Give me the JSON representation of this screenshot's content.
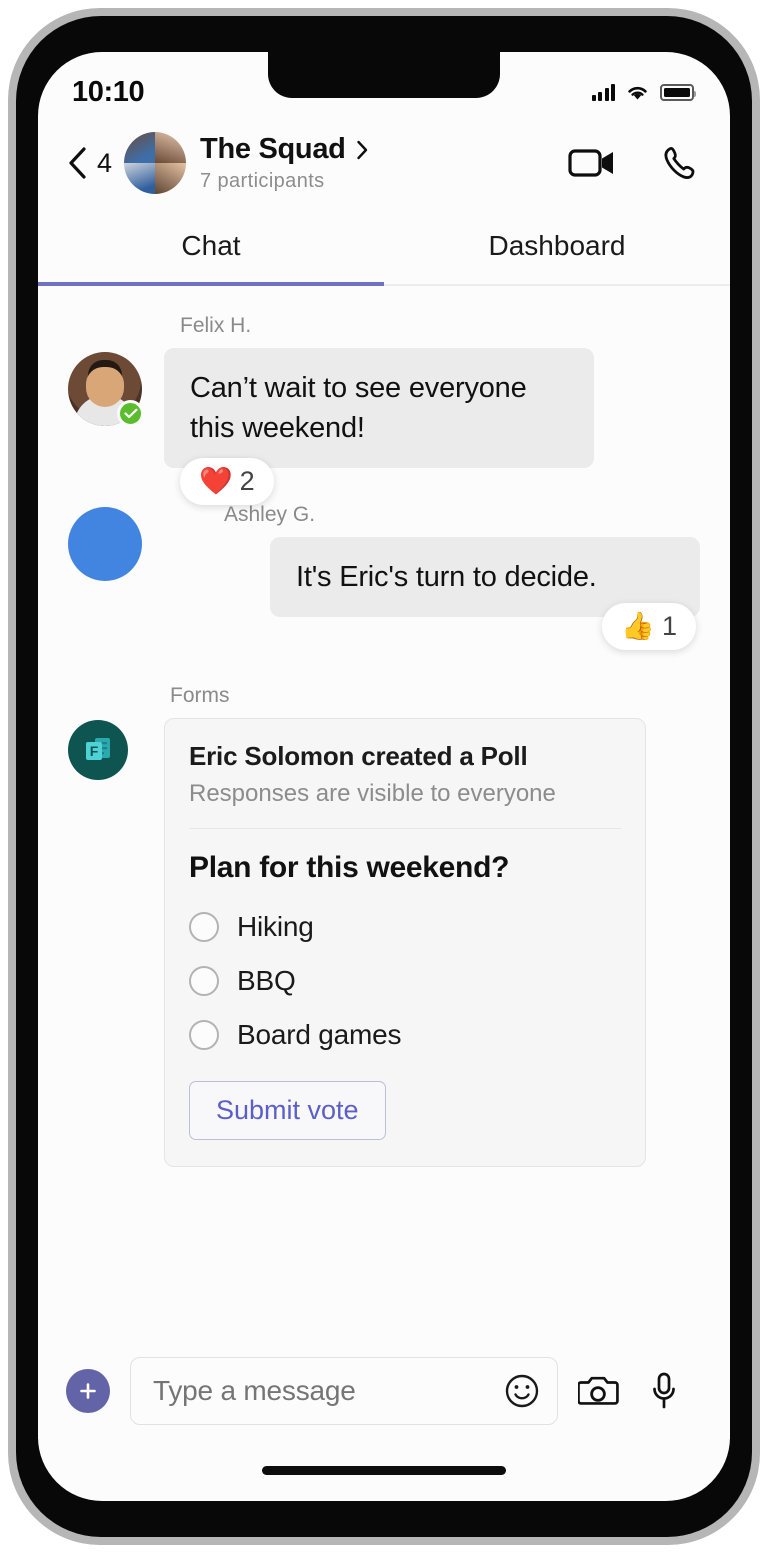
{
  "status_bar": {
    "time": "10:10",
    "signal_icon": "signal-bars-icon",
    "wifi_icon": "wifi-icon",
    "battery_icon": "battery-icon"
  },
  "header": {
    "back_icon": "chevron-left-icon",
    "back_count": "4",
    "avatar_icon": "group-avatar",
    "title": "The Squad",
    "title_chevron_icon": "chevron-right-icon",
    "participants": "7 participants",
    "video_call_icon": "video-camera-icon",
    "audio_call_icon": "phone-icon"
  },
  "tabs": [
    {
      "label": "Chat",
      "active": true
    },
    {
      "label": "Dashboard",
      "active": false
    }
  ],
  "accent_colors": {
    "tab_indicator": "#6e72c0",
    "teams_purple": "#6264a7",
    "submit_vote_text": "#5b5fc7",
    "presence_available": "#5bbc2e",
    "forms_badge": "#0e5450"
  },
  "messages": [
    {
      "sender": "Felix H.",
      "text": "Can’t wait to see everyone this weekend!",
      "align": "left",
      "presence": "available",
      "reaction": {
        "emoji": "❤️",
        "name": "heart-reaction",
        "count": "2"
      }
    },
    {
      "sender": "Ashley G.",
      "text": "It's Eric's turn to decide.",
      "align": "right",
      "reaction": {
        "emoji": "👍",
        "name": "thumbs-up-reaction",
        "count": "1"
      }
    }
  ],
  "poll": {
    "app_label": "Forms",
    "app_icon": "microsoft-forms-icon",
    "created_by": "Eric Solomon created a Poll",
    "visibility": "Responses are visible to everyone",
    "question": "Plan for this weekend?",
    "options": [
      "Hiking",
      "BBQ",
      "Board games"
    ],
    "submit_label": "Submit vote"
  },
  "composer": {
    "add_icon": "plus-icon",
    "placeholder": "Type a message",
    "value": "",
    "emoji_icon": "smiley-face-icon",
    "camera_icon": "camera-icon",
    "mic_icon": "microphone-icon"
  }
}
